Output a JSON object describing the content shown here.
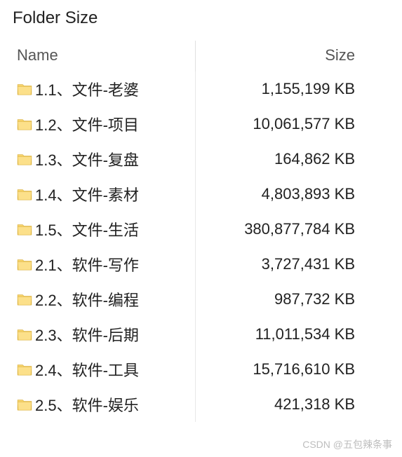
{
  "title": "Folder Size",
  "columns": {
    "name": "Name",
    "size": "Size"
  },
  "rows": [
    {
      "name": "1.1、文件-老婆",
      "size": "1,155,199 KB"
    },
    {
      "name": "1.2、文件-项目",
      "size": "10,061,577 KB"
    },
    {
      "name": "1.3、文件-复盘",
      "size": "164,862 KB"
    },
    {
      "name": "1.4、文件-素材",
      "size": "4,803,893 KB"
    },
    {
      "name": "1.5、文件-生活",
      "size": "380,877,784 KB"
    },
    {
      "name": "2.1、软件-写作",
      "size": "3,727,431 KB"
    },
    {
      "name": "2.2、软件-编程",
      "size": "987,732 KB"
    },
    {
      "name": "2.3、软件-后期",
      "size": "11,011,534 KB"
    },
    {
      "name": "2.4、软件-工具",
      "size": "15,716,610 KB"
    },
    {
      "name": "2.5、软件-娱乐",
      "size": "421,318 KB"
    }
  ],
  "watermark": "CSDN @五包辣条事"
}
